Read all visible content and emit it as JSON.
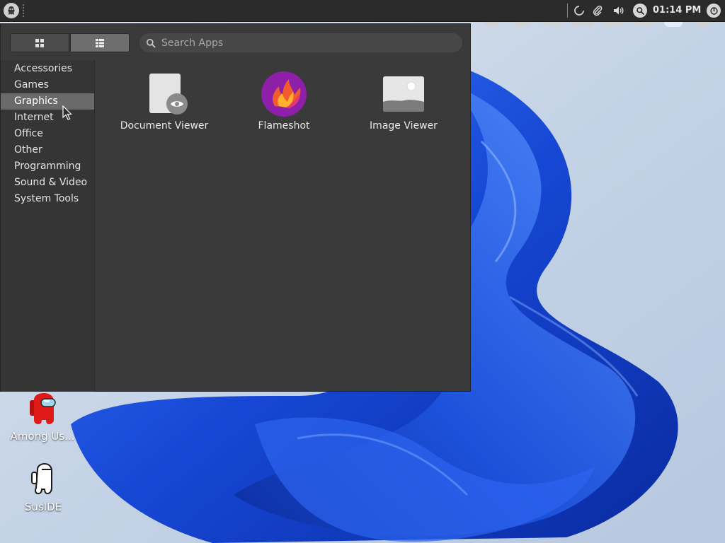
{
  "panel": {
    "clock": "01:14 PM",
    "icons": [
      "menu-logo-icon",
      "loading-icon",
      "paperclip-icon",
      "volume-icon",
      "search-icon",
      "power-icon"
    ]
  },
  "menu": {
    "search_placeholder": "Search Apps",
    "view_buttons": [
      "grid-view-icon",
      "list-view-icon"
    ],
    "categories": [
      "Accessories",
      "Games",
      "Graphics",
      "Internet",
      "Office",
      "Other",
      "Programming",
      "Sound & Video",
      "System Tools"
    ],
    "selected_category": "Graphics",
    "apps": [
      {
        "label": "Document Viewer",
        "icon": "document-viewer-icon"
      },
      {
        "label": "Flameshot",
        "icon": "flameshot-icon"
      },
      {
        "label": "Image Viewer",
        "icon": "image-viewer-icon"
      }
    ]
  },
  "desktop": {
    "icons": [
      {
        "label": "Among Us...",
        "icon": "among-us-icon"
      },
      {
        "label": "SusIDE",
        "icon": "suside-icon"
      }
    ]
  },
  "colors": {
    "panel_bg": "#2b2b2b",
    "menu_bg": "#3a3a3a",
    "sidebar_bg": "#353535",
    "selected_bg": "#6a6a6a",
    "wallpaper_blue": "#1f4fd6"
  }
}
